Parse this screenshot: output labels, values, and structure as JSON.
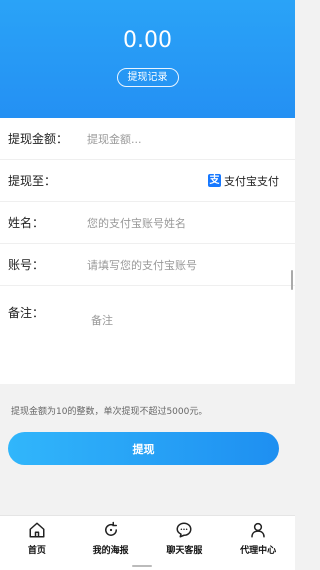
{
  "header": {
    "balance": "0.00",
    "record_label": "提现记录"
  },
  "form": {
    "amount_label": "提现金额：",
    "amount_placeholder": "提现金额...",
    "to_label": "提现至：",
    "to_value": "支付宝支付",
    "name_label": "姓名：",
    "name_placeholder": "您的支付宝账号姓名",
    "account_label": "账号：",
    "account_placeholder": "请填写您的支付宝账号",
    "note_label": "备注：",
    "note_placeholder": "备注"
  },
  "tip": "提现金额为10的整数，单次提现不超过5000元。",
  "withdraw_label": "提现",
  "tabbar": {
    "items": [
      {
        "label": "首页",
        "icon": "home-icon"
      },
      {
        "label": "我的海报",
        "icon": "refresh-icon"
      },
      {
        "label": "聊天客服",
        "icon": "chat-icon"
      },
      {
        "label": "代理中心",
        "icon": "user-icon"
      }
    ]
  },
  "colors": {
    "accent": "#2490f3",
    "alipay": "#1678ff"
  }
}
